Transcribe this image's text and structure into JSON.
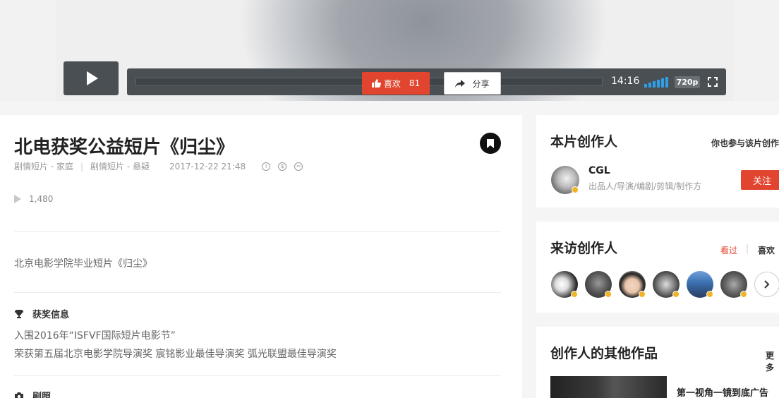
{
  "player": {
    "time": "14:16",
    "quality": "720p"
  },
  "video": {
    "title": "北电获奖公益短片《归尘》",
    "categories": [
      "剧情短片 - 家庭",
      "剧情短片 - 悬疑"
    ],
    "date": "2017-12-22 21:48",
    "views": "1,480",
    "like_label": "喜欢",
    "like_count": "81",
    "share_label": "分享",
    "description": "北京电影学院毕业短片《归尘》"
  },
  "awards": {
    "heading": "获奖信息",
    "lines": [
      "入围2016年“ISFVF国际短片电影节”",
      "荣获第五届北京电影学院导演奖 宸铭影业最佳导演奖 弧光联盟最佳导演奖"
    ]
  },
  "stills": {
    "heading": "剧照"
  },
  "creators_card": {
    "title": "本片创作人",
    "join_link": "你也参与该片创作",
    "creator_name": "CGL",
    "creator_roles": "出品人/导演/编剧/剪辑/制作方",
    "follow_label": "关注"
  },
  "visitors_card": {
    "title": "来访创作人",
    "tabs": [
      "看过",
      "喜欢"
    ]
  },
  "other_works_card": {
    "title": "创作人的其他作品",
    "more_label": "更多",
    "first_work_title": "第一视角一镜到底广告"
  },
  "colors": {
    "accent": "#e2452f",
    "volume": "#2f9ee8",
    "badge": "#f0b429"
  }
}
